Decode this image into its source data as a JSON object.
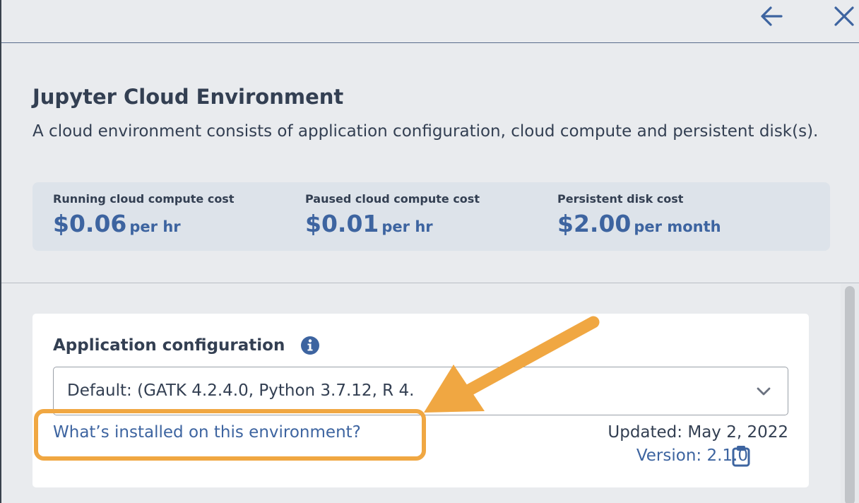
{
  "header": {
    "back_icon": "arrow-left-icon",
    "close_icon": "close-icon"
  },
  "title": "Jupyter Cloud Environment",
  "description": "A cloud environment consists of application configuration, cloud compute and persistent disk(s).",
  "costs": [
    {
      "label": "Running cloud compute cost",
      "amount": "$0.06",
      "unit": "per hr"
    },
    {
      "label": "Paused cloud compute cost",
      "amount": "$0.01",
      "unit": "per hr"
    },
    {
      "label": "Persistent disk cost",
      "amount": "$2.00",
      "unit": "per month"
    }
  ],
  "app_config": {
    "title": "Application configuration",
    "info_icon": "info-icon",
    "selected": "Default: (GATK 4.2.4.0, Python 3.7.12, R 4.",
    "installed_link": "What’s installed on this environment?",
    "updated": "Updated: May 2, 2022",
    "version": "Version: 2.1.0",
    "copy_icon": "clipboard-icon"
  },
  "colors": {
    "accent": "#3d64a0",
    "text": "#333f52",
    "background": "#e9ebee",
    "cost_box": "#dde3ea",
    "annotation": "#f0a742"
  }
}
